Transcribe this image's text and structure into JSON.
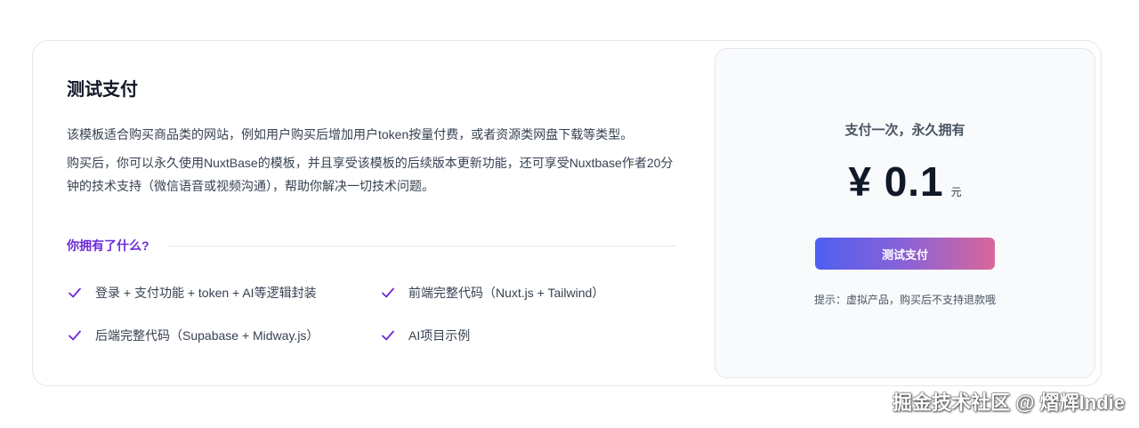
{
  "product": {
    "title": "测试支付",
    "description1": "该模板适合购买商品类的网站，例如用户购买后增加用户token按量付费，或者资源类网盘下载等类型。",
    "description2": "购买后，你可以永久使用NuxtBase的模板，并且享受该模板的后续版本更新功能，还可享受Nuxtbase作者20分钟的技术支持（微信语音或视频沟通），帮助你解决一切技术问题。",
    "section_label": "你拥有了什么?",
    "features": [
      "登录 + 支付功能 + token + AI等逻辑封装",
      "前端完整代码（Nuxt.js + Tailwind）",
      "后端完整代码（Supabase + Midway.js）",
      "AI项目示例"
    ]
  },
  "pricing": {
    "headline": "支付一次，永久拥有",
    "price": "¥ 0.1",
    "unit": "元",
    "button_label": "测试支付",
    "hint": "提示：虚拟产品，购买后不支持退款哦"
  },
  "watermark": "掘金技术社区 @ 熠辉Indie",
  "colors": {
    "accent": "#6d28d9",
    "button_gradient_start": "#4f5ff0",
    "button_gradient_end": "#d9679a"
  }
}
